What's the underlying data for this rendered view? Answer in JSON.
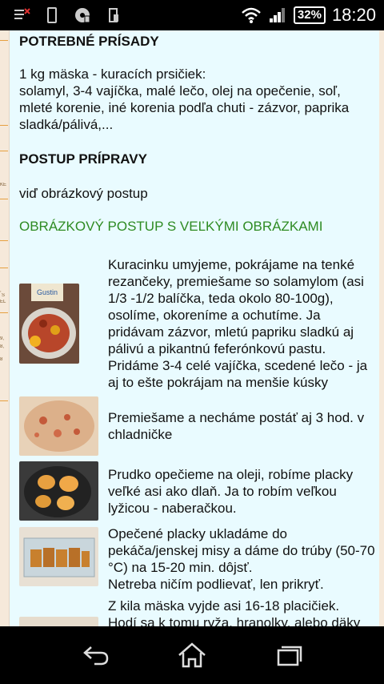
{
  "status": {
    "battery": "32%",
    "time": "18:20",
    "icons": [
      "notification-icon",
      "phone-icon",
      "media-icon",
      "storage-icon",
      "wifi-icon",
      "signal-icon",
      "battery-icon"
    ]
  },
  "sidebar_fragments": [
    "KE",
    ",",
    "S",
    "EL",
    "9,",
    "8,",
    "8"
  ],
  "recipe": {
    "ingredients_title": "POTREBNÉ PRÍSADY",
    "ingredients_line1": "1 kg mäska - kuracích prsičiek:",
    "ingredients_line2": "solamyl, 3-4 vajíčka, malé lečo, olej na opečenie, soľ, mleté korenie, iné korenia podľa chuti - zázvor, paprika sladká/pálivá,...",
    "method_title": "POSTUP PRÍPRAVY",
    "method_text": "viď obrázkový postup",
    "photo_link": "OBRÁZKOVÝ POSTUP S VEĽKÝMI OBRÁZKAMI",
    "steps": [
      {
        "text": "Kuracinku umyjeme, pokrájame na tenké rezančeky, premiešame so solamylom (asi 1/3 -1/2 balíčka, teda okolo 80-100g), osolíme, okoreníme a ochutíme. Ja pridávam zázvor, mletú papriku sladkú aj pálivú a pikantnú feferónkovú pastu. Pridáme 3-4 celé vajíčka, scedené lečo - ja aj to ešte pokrájam na menšie kúsky",
        "label": "Gustin"
      },
      {
        "text": "Premiešame a necháme postáť aj 3 hod. v chladničke"
      },
      {
        "text": "Prudko opečieme na oleji, robíme placky veľké asi ako dlaň. Ja to robím veľkou lyžicou - naberačkou."
      },
      {
        "text": "Opečené placky ukladáme do pekáča/jenskej misy a dáme do trúby (50-70 °C) na 15-20 min. dôjsť.\nNetreba ničím podlievať, len prikryť."
      },
      {
        "text": "Z kila mäska vyjde asi 16-18 placičiek.\nHodí sa k tomu ryža, hranolky, alebo däky"
      }
    ]
  },
  "colors": {
    "link_green": "#2e8b22",
    "page_bg": "#e9fbff",
    "strip": "#f6e9da"
  }
}
